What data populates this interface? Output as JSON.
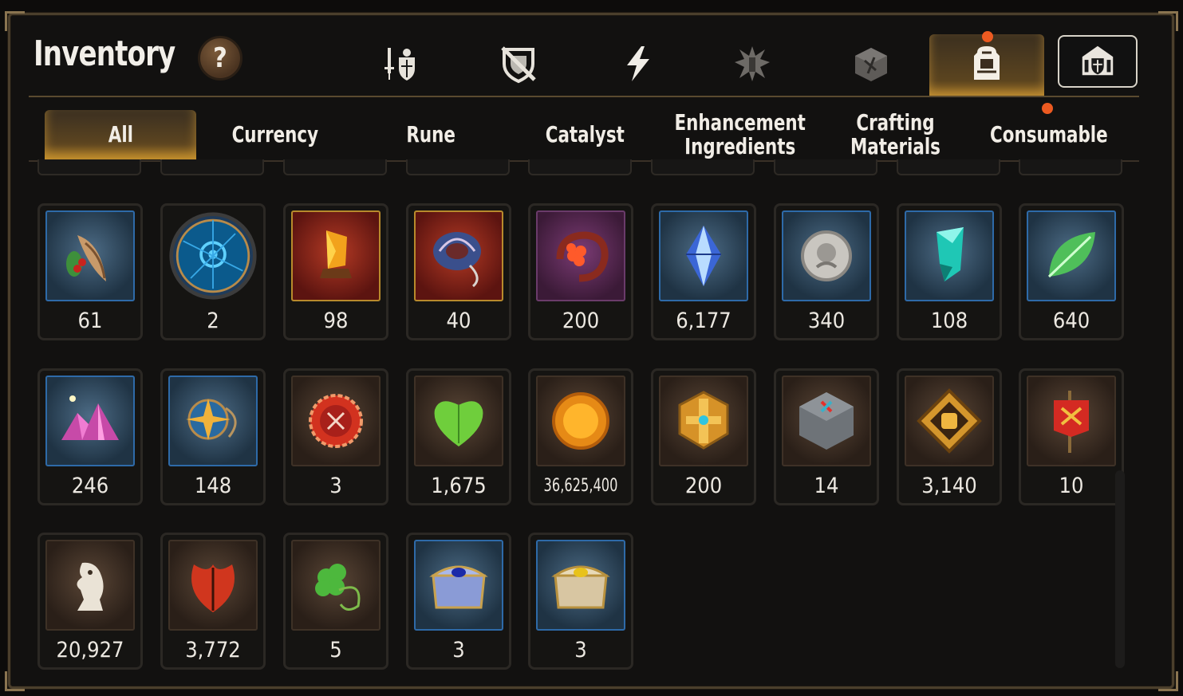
{
  "header": {
    "title": "Inventory",
    "help_label": "?"
  },
  "category_icons": [
    "sword-shield-icon",
    "broken-shield-icon",
    "lightning-icon",
    "spiky-relic-icon",
    "cube-rune-icon",
    "backpack-icon",
    "vault-shield-icon"
  ],
  "active_category": "backpack-icon",
  "tabs": [
    {
      "label": "All"
    },
    {
      "label": "Currency"
    },
    {
      "label": "Rune"
    },
    {
      "label": "Catalyst"
    },
    {
      "label": "Enhancement\nIngredients"
    },
    {
      "label": "Crafting\nMaterials"
    },
    {
      "label": "Consumable"
    }
  ],
  "active_tab": "All",
  "items": [
    {
      "icon": "feather-berry-icon",
      "count": "61"
    },
    {
      "icon": "blue-portal-disc-icon",
      "count": "2"
    },
    {
      "icon": "amber-crystal-icon",
      "count": "98"
    },
    {
      "icon": "rune-ring-icon",
      "count": "40"
    },
    {
      "icon": "flower-ring-icon",
      "count": "200"
    },
    {
      "icon": "blue-diamond-icon",
      "count": "6,177"
    },
    {
      "icon": "silver-coin-icon",
      "count": "340"
    },
    {
      "icon": "teal-crystal-icon",
      "count": "108"
    },
    {
      "icon": "green-leaf-icon",
      "count": "640"
    },
    {
      "icon": "pink-crystal-cluster-icon",
      "count": "246"
    },
    {
      "icon": "compass-star-amulet-icon",
      "count": "148"
    },
    {
      "icon": "red-seal-icon",
      "count": "3"
    },
    {
      "icon": "green-heart-icon",
      "count": "1,675"
    },
    {
      "icon": "gold-sun-coin-icon",
      "count": "36,625,400"
    },
    {
      "icon": "golden-hex-emblem-icon",
      "count": "200"
    },
    {
      "icon": "stone-compass-cube-icon",
      "count": "14"
    },
    {
      "icon": "fist-emblem-icon",
      "count": "3,140"
    },
    {
      "icon": "war-banner-icon",
      "count": "10"
    },
    {
      "icon": "chess-knight-icon",
      "count": "20,927"
    },
    {
      "icon": "red-leaf-icon",
      "count": "3,772"
    },
    {
      "icon": "clover-amulet-icon",
      "count": "5"
    },
    {
      "icon": "blue-gem-chest-icon",
      "count": "3"
    },
    {
      "icon": "gold-gem-chest-icon",
      "count": "3"
    }
  ]
}
